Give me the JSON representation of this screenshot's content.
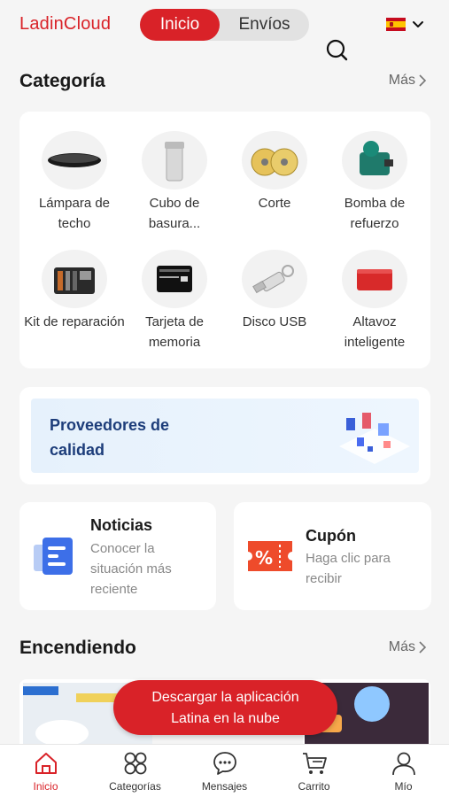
{
  "header": {
    "logo": "LadinCloud",
    "tabs": [
      {
        "label": "Inicio",
        "active": true
      },
      {
        "label": "Envíos",
        "active": false
      }
    ],
    "language_flag": "spain-flag-icon"
  },
  "categories": {
    "title": "Categoría",
    "more": "Más",
    "items": [
      {
        "label": "Lámpara de techo",
        "icon": "ceiling-lamp"
      },
      {
        "label": "Cubo de basura...",
        "icon": "trash-bin"
      },
      {
        "label": "Corte",
        "icon": "cutting-disc"
      },
      {
        "label": "Bomba de refuerzo",
        "icon": "booster-pump"
      },
      {
        "label": "Kit de reparación",
        "icon": "repair-kit"
      },
      {
        "label": "Tarjeta de memoria",
        "icon": "memory-card"
      },
      {
        "label": "Disco USB",
        "icon": "usb-drive"
      },
      {
        "label": "Altavoz inteligente",
        "icon": "smart-speaker"
      }
    ]
  },
  "suppliers_banner": {
    "text": "Proveedores de calidad"
  },
  "news": {
    "title": "Noticias",
    "subtitle": "Conocer la situación más reciente"
  },
  "coupon": {
    "title": "Cupón",
    "subtitle": "Haga clic para recibir"
  },
  "trending": {
    "title": "Encendiendo",
    "more": "Más"
  },
  "download_banner": {
    "line1": "Descargar la aplicación",
    "line2": "Latina en la nube"
  },
  "tabbar": {
    "items": [
      {
        "label": "Inicio",
        "icon": "home-icon",
        "active": true
      },
      {
        "label": "Categorías",
        "icon": "grid-icon",
        "active": false
      },
      {
        "label": "Mensajes",
        "icon": "chat-icon",
        "active": false
      },
      {
        "label": "Carrito",
        "icon": "cart-icon",
        "active": false
      },
      {
        "label": "Mío",
        "icon": "user-icon",
        "active": false
      }
    ]
  },
  "colors": {
    "brand": "#d92228",
    "background": "#f5f5f5",
    "card": "#ffffff"
  }
}
